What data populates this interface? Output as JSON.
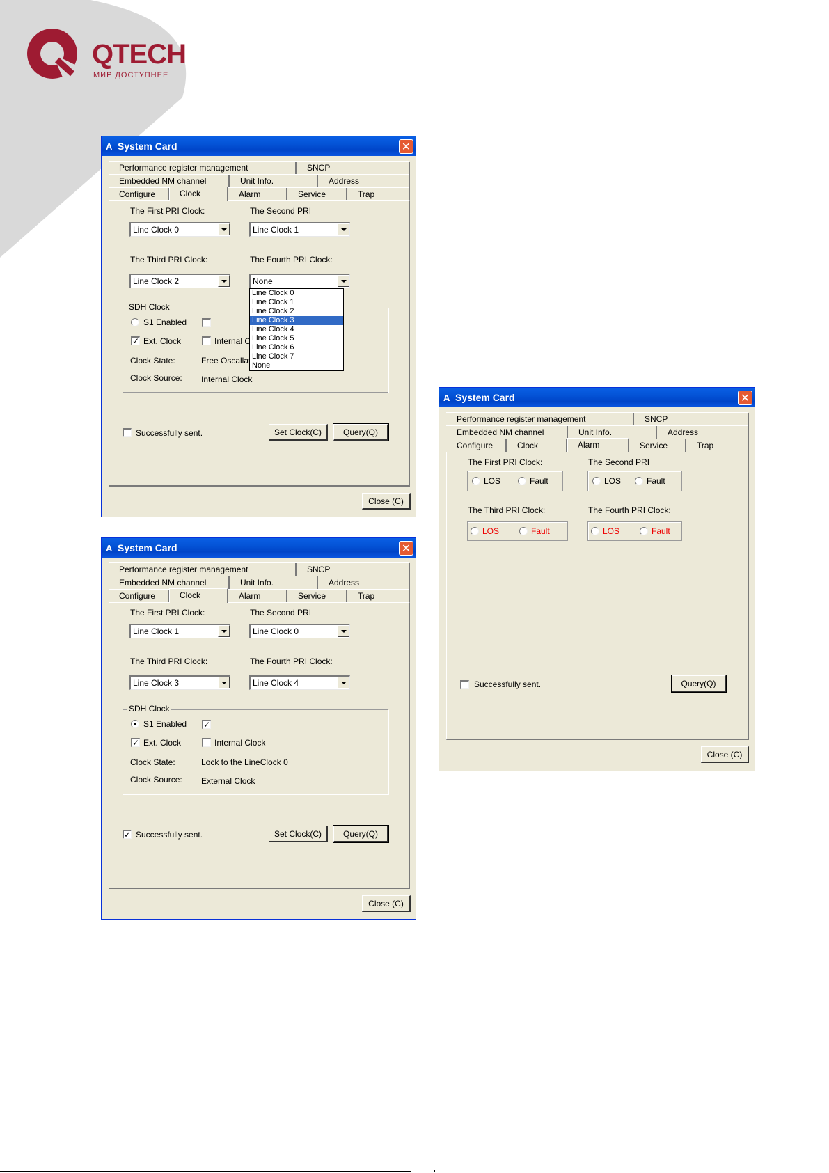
{
  "brand": {
    "name": "QTECH",
    "tagline": "МИР ДОСТУПНЕЕ"
  },
  "tabs": {
    "row1": [
      "Performance register management",
      "SNCP"
    ],
    "row2": [
      "Embedded NM channel",
      "Unit Info.",
      "Address"
    ],
    "row3": [
      "Configure",
      "Clock",
      "Alarm",
      "Service",
      "Trap"
    ]
  },
  "labels": {
    "first_pri": "The First PRI Clock:",
    "second_pri": "The Second PRI",
    "third_pri": "The Third PRI Clock:",
    "fourth_pri": "The Fourth PRI Clock:",
    "sdh_clock": "SDH Clock",
    "s1_enabled": "S1 Enabled",
    "ext_clock": "Ext. Clock",
    "internal_clock": "Internal Clock",
    "internal_clock_clipped": "Internal Cl",
    "clock_state": "Clock State:",
    "clock_source": "Clock Source:",
    "successfully_sent": "Successfully sent.",
    "set_clock": "Set Clock(C)",
    "query": "Query(Q)",
    "close": "Close (C)",
    "los": "LOS",
    "fault": "Fault"
  },
  "dialog1": {
    "title": "System Card",
    "first": "Line Clock 0",
    "second": "Line Clock 1",
    "third": "Line Clock 2",
    "fourth": "None",
    "s1_enabled": false,
    "s1_check": false,
    "ext_clock": true,
    "internal_clock": false,
    "clock_state": "Free Oscallati",
    "clock_source": "Internal Clock",
    "sent": false,
    "dropdown_options": [
      "Line Clock 0",
      "Line Clock 1",
      "Line Clock 2",
      "Line Clock 3",
      "Line Clock 4",
      "Line Clock 5",
      "Line Clock 6",
      "Line Clock 7",
      "None"
    ],
    "dropdown_selected": "Line Clock 3"
  },
  "dialog2": {
    "title": "System Card",
    "first": "Line Clock 1",
    "second": "Line Clock 0",
    "third": "Line Clock 3",
    "fourth": "Line Clock 4",
    "s1_enabled": true,
    "s1_check": true,
    "ext_clock": true,
    "internal_clock": false,
    "clock_state": "Lock to the LineClock 0",
    "clock_source": "External Clock",
    "sent": true
  },
  "dialog3": {
    "title": "System Card",
    "sent": false
  },
  "colors": {
    "alarm_red": "#e00000",
    "title_blue": "#0453d6",
    "dialog_bg": "#ece9d8",
    "brand": "#9e1b32"
  }
}
